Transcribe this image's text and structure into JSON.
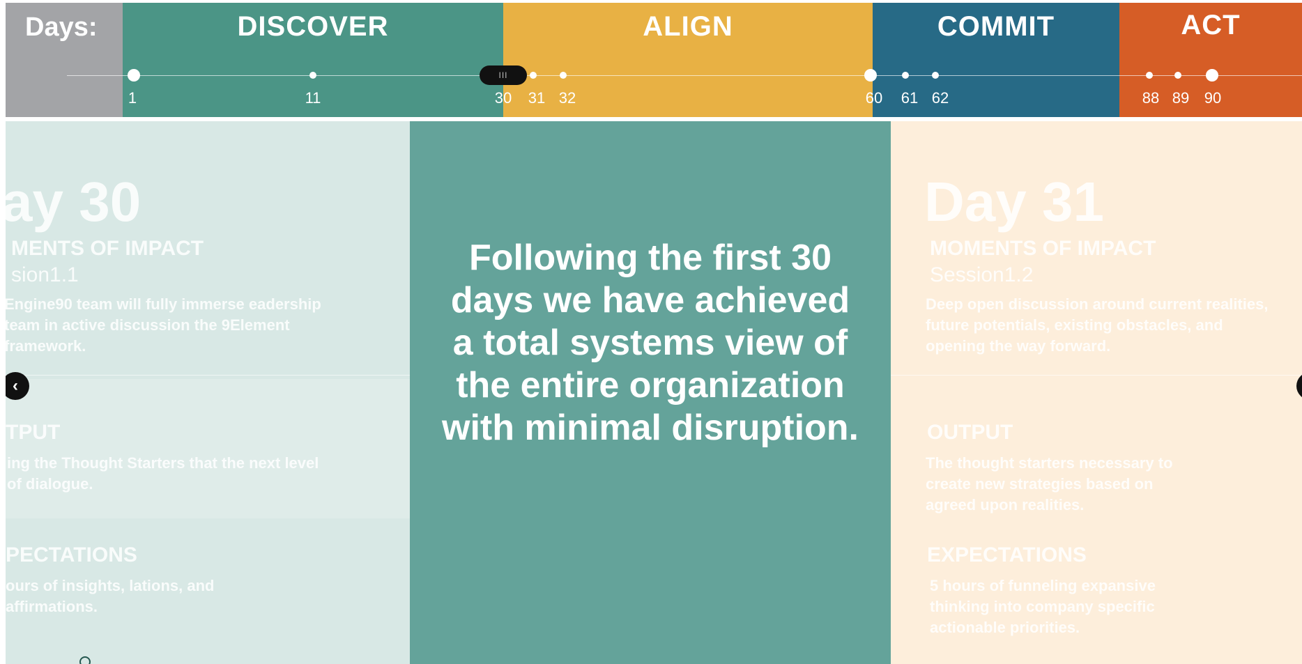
{
  "timeline": {
    "days_label": "Days:",
    "phases": [
      {
        "name": "DISCOVER",
        "color": "#4b9586"
      },
      {
        "name": "ALIGN",
        "color": "#e8b144"
      },
      {
        "name": "COMMIT",
        "color": "#276a86"
      },
      {
        "name": "ACT",
        "color": "#d65d26"
      }
    ],
    "day_markers": [
      "1",
      "11",
      "30",
      "31",
      "32",
      "60",
      "61",
      "62",
      "88",
      "89",
      "90"
    ],
    "handle_glyph": "III"
  },
  "slides": {
    "left": {
      "day_title": "ay 30",
      "moments": "MENTS OF IMPACT",
      "session": "sion1.1",
      "description": "Engine90 team will fully immerse eadership team in active discussion the 9Element framework.",
      "output_heading": "TPUT",
      "output_text": "ing the Thought Starters that the next level of dialogue.",
      "expectations_heading": "PECTATIONS",
      "expectations_text": "ours of insights, lations, and affirmations."
    },
    "center": {
      "text": "Following the first 30 days we have achieved a total systems view of the entire organization with minimal disruption."
    },
    "right": {
      "day_title": "Day 31",
      "moments": "MOMENTS OF IMPACT",
      "session": "Session1.2",
      "description": "Deep open discussion around current realities, future potentials, existing obstacles, and opening the way forward.",
      "output_heading": "OUTPUT",
      "output_text": "The thought starters necessary to create new strategies based on agreed upon realities.",
      "expectations_heading": "EXPECTATIONS",
      "expectations_text": "5 hours of funneling expansive thinking into company specific actionable priorities."
    }
  },
  "nav": {
    "prev_icon": "chevron-left-icon",
    "next_icon": "chevron-right-icon",
    "prev_glyph": "‹",
    "next_glyph": "›"
  }
}
